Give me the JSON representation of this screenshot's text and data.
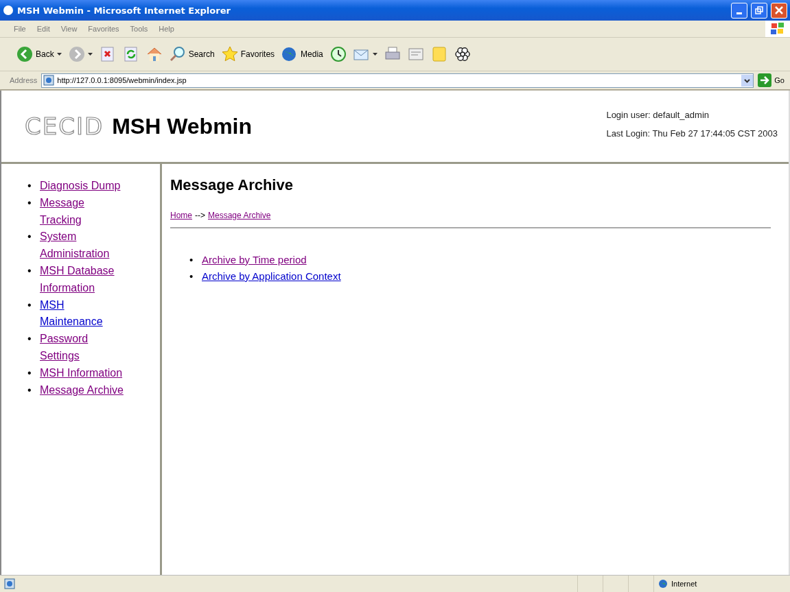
{
  "window": {
    "title": "MSH Webmin - Microsoft Internet Explorer"
  },
  "menu": [
    "File",
    "Edit",
    "View",
    "Favorites",
    "Tools",
    "Help"
  ],
  "toolbar": [
    {
      "kind": "back",
      "label": "Back"
    },
    {
      "kind": "forward"
    },
    {
      "kind": "stop"
    },
    {
      "kind": "refresh"
    },
    {
      "kind": "home"
    },
    {
      "kind": "search",
      "label": "Search"
    },
    {
      "kind": "favorites",
      "label": "Favorites"
    },
    {
      "kind": "media",
      "label": "Media"
    },
    {
      "kind": "history"
    },
    {
      "kind": "mail"
    },
    {
      "kind": "print"
    },
    {
      "kind": "edit"
    },
    {
      "kind": "note"
    },
    {
      "kind": "flower"
    }
  ],
  "address": {
    "label": "Address",
    "value": "http://127.0.0.1:8095/webmin/index.jsp",
    "go": "Go"
  },
  "header": {
    "logo": "CECID",
    "title": "MSH Webmin",
    "login_user": "Login user: default_admin",
    "last_login": "Last Login: Thu Feb 27 17:44:05 CST 2003"
  },
  "sidebar": {
    "marker": "•",
    "items": [
      {
        "label": "Diagnosis Dump",
        "visited": true
      },
      {
        "label": "Message Tracking",
        "visited": true
      },
      {
        "label": "System Administration",
        "visited": true
      },
      {
        "label": "MSH Database Information",
        "visited": true
      },
      {
        "label": "MSH Maintenance",
        "visited": false
      },
      {
        "label": "Password Settings",
        "visited": true
      },
      {
        "label": "MSH Information",
        "visited": true
      },
      {
        "label": "Message Archive",
        "visited": true
      }
    ]
  },
  "main": {
    "heading": "Message Archive",
    "breadcrumb": [
      {
        "label": "Home",
        "visited": true
      },
      {
        "label": "Message Archive",
        "visited": true
      }
    ],
    "breadcrumb_separator": "-->",
    "marker": "•",
    "links": [
      {
        "label": "Archive by Time period",
        "visited": true
      },
      {
        "label": "Archive by Application Context",
        "visited": false
      }
    ]
  },
  "status_bar": {
    "zone": "Internet"
  }
}
